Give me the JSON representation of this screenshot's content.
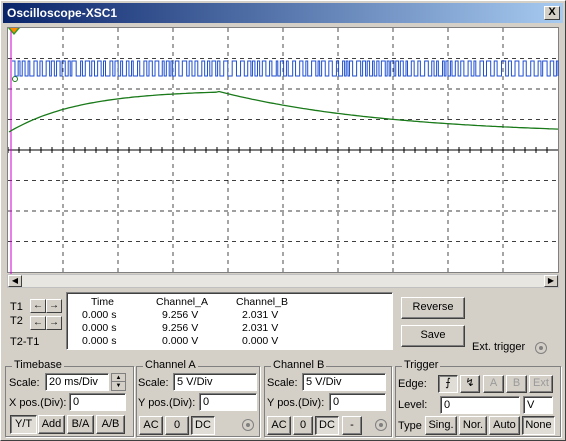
{
  "window": {
    "title": "Oscilloscope-XSC1",
    "close_label": "X"
  },
  "colors": {
    "channel_a": "#1f4fd0",
    "channel_b": "#1a7a1a",
    "grid": "#000000",
    "cursor": "#cc00cc"
  },
  "measurements": {
    "headers": [
      "Time",
      "Channel_A",
      "Channel_B"
    ],
    "rows": [
      {
        "label": "T1",
        "time": "0.000 s",
        "a": "9.256 V",
        "b": "2.031 V"
      },
      {
        "label": "T2",
        "time": "0.000 s",
        "a": "9.256 V",
        "b": "2.031 V"
      },
      {
        "label": "T2-T1",
        "time": "0.000 s",
        "a": "0.000 V",
        "b": "0.000 V"
      }
    ]
  },
  "actions": {
    "reverse": "Reverse",
    "save": "Save",
    "ext_trigger": "Ext. trigger"
  },
  "timebase": {
    "title": "Timebase",
    "scale_label": "Scale:",
    "scale_value": "20 ms/Div",
    "xpos_label": "X pos.(Div):",
    "xpos_value": "0",
    "modes": [
      "Y/T",
      "Add",
      "B/A",
      "A/B"
    ]
  },
  "channel_a": {
    "title": "Channel A",
    "scale_label": "Scale:",
    "scale_value": "5  V/Div",
    "ypos_label": "Y pos.(Div):",
    "ypos_value": "0",
    "coupling": [
      "AC",
      "0",
      "DC"
    ]
  },
  "channel_b": {
    "title": "Channel B",
    "scale_label": "Scale:",
    "scale_value": "5  V/Div",
    "ypos_label": "Y pos.(Div):",
    "ypos_value": "0",
    "coupling": [
      "AC",
      "0",
      "DC",
      "-"
    ]
  },
  "trigger": {
    "title": "Trigger",
    "edge_label": "Edge:",
    "edge_sources": [
      "A",
      "B",
      "Ext"
    ],
    "level_label": "Level:",
    "level_value": "0",
    "level_unit": "V",
    "type_label": "Type",
    "types": [
      "Sing.",
      "Nor.",
      "Auto",
      "None"
    ]
  }
}
